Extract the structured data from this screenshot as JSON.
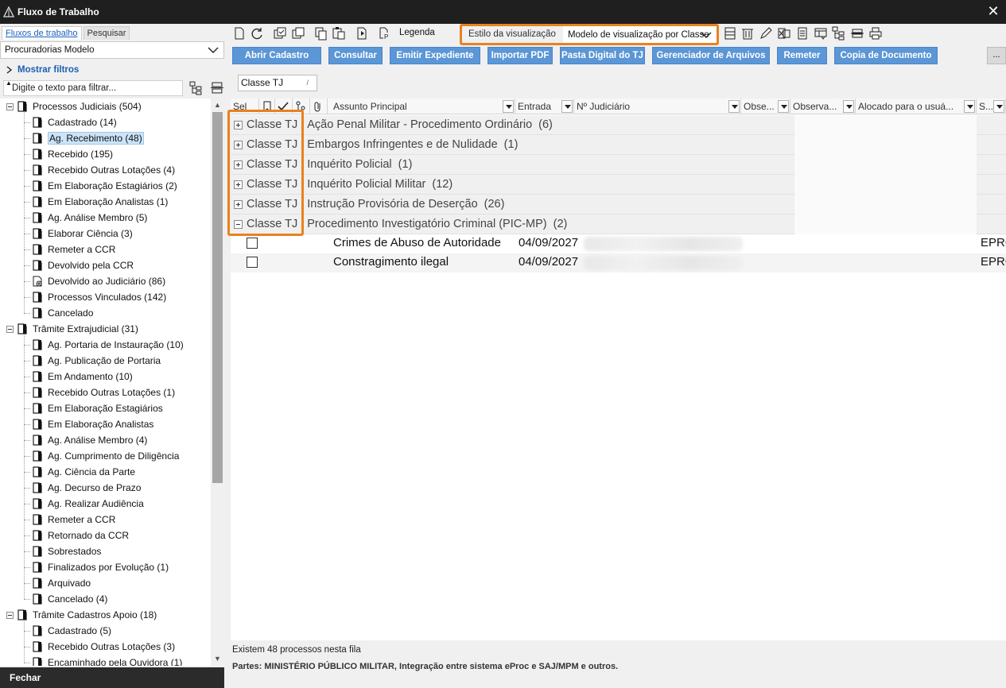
{
  "window": {
    "title": "Fluxo de Trabalho"
  },
  "left": {
    "tabs": [
      {
        "label": "Fluxos de trabalho"
      },
      {
        "label": "Pesquisar"
      }
    ],
    "model": "Procuradorias Modelo",
    "show_filters": "Mostrar filtros",
    "filter_placeholder": "Digite o texto para filtrar...",
    "tree": [
      {
        "label": "Processos Judiciais (504)",
        "level": 0
      },
      {
        "label": "Cadastrado (14)",
        "level": 1
      },
      {
        "label": "Ag. Recebimento (48)",
        "level": 1,
        "selected": true
      },
      {
        "label": "Recebido (195)",
        "level": 1
      },
      {
        "label": "Recebido Outras Lotações (4)",
        "level": 1
      },
      {
        "label": "Em Elaboração Estagiários (2)",
        "level": 1
      },
      {
        "label": "Em Elaboração Analistas (1)",
        "level": 1
      },
      {
        "label": "Ag. Análise Membro (5)",
        "level": 1
      },
      {
        "label": "Elaborar Ciência (3)",
        "level": 1
      },
      {
        "label": "Remeter a CCR",
        "level": 1
      },
      {
        "label": "Devolvido pela CCR",
        "level": 1
      },
      {
        "label": "Devolvido ao Judiciário (86)",
        "level": 1,
        "icon": "gear"
      },
      {
        "label": "Processos Vinculados (142)",
        "level": 1
      },
      {
        "label": "Cancelado",
        "level": 1
      },
      {
        "label": "Trâmite Extrajudicial (31)",
        "level": 0
      },
      {
        "label": "Ag. Portaria de Instauração (10)",
        "level": 1
      },
      {
        "label": "Ag. Publicação de Portaria",
        "level": 1
      },
      {
        "label": "Em Andamento (10)",
        "level": 1
      },
      {
        "label": "Recebido Outras Lotações (1)",
        "level": 1
      },
      {
        "label": "Em Elaboração Estagiários",
        "level": 1
      },
      {
        "label": "Em Elaboração Analistas",
        "level": 1
      },
      {
        "label": "Ag. Análise Membro (4)",
        "level": 1
      },
      {
        "label": "Ag. Cumprimento de Diligência",
        "level": 1
      },
      {
        "label": "Ag. Ciência da Parte",
        "level": 1
      },
      {
        "label": "Ag. Decurso de Prazo",
        "level": 1
      },
      {
        "label": "Ag. Realizar Audiência",
        "level": 1
      },
      {
        "label": "Remeter a CCR",
        "level": 1
      },
      {
        "label": "Retornado da CCR",
        "level": 1
      },
      {
        "label": "Sobrestados",
        "level": 1
      },
      {
        "label": "Finalizados por Evolução (1)",
        "level": 1
      },
      {
        "label": "Arquivado",
        "level": 1
      },
      {
        "label": "Cancelado (4)",
        "level": 1
      },
      {
        "label": "Trâmite Cadastros Apoio (18)",
        "level": 0
      },
      {
        "label": "Cadastrado (5)",
        "level": 1
      },
      {
        "label": "Recebido Outras Lotações (3)",
        "level": 1
      },
      {
        "label": "Encaminhado pela Ouvidora (1)",
        "level": 1
      }
    ],
    "close_label": "Fechar"
  },
  "toolbar": {
    "legend_label": "Legenda",
    "view_style_label": "Estilo da visualização",
    "view_style_value": "Modelo de visualização por Classe"
  },
  "actions": [
    {
      "label": "Abrir Cadastro"
    },
    {
      "label": "Consultar"
    },
    {
      "label": "Emitir Expediente"
    },
    {
      "label": "Importar PDF"
    },
    {
      "label": "Pasta Digital do TJ"
    },
    {
      "label": "Gerenciador de Arquivos"
    },
    {
      "label": "Remeter"
    },
    {
      "label": "Copia de Documento"
    }
  ],
  "more_label": "...",
  "grid": {
    "group_chip": "Classe TJ",
    "columns": [
      "Sel",
      "Assunto Principal",
      "Entrada",
      "Nº Judiciário",
      "Obse...",
      "Observa...",
      "Alocado para o usuá...",
      "S..."
    ],
    "groups": [
      {
        "prefix": "Classe TJ :",
        "name": "Ação Penal Militar - Procedimento Ordinário",
        "count": "(6)",
        "expanded": false
      },
      {
        "prefix": "Classe TJ :",
        "name": "Embargos Infringentes e de Nulidade",
        "count": "(1)",
        "expanded": false
      },
      {
        "prefix": "Classe TJ :",
        "name": "Inquérito Policial",
        "count": "(1)",
        "expanded": false
      },
      {
        "prefix": "Classe TJ :",
        "name": "Inquérito Policial Militar",
        "count": "(12)",
        "expanded": false
      },
      {
        "prefix": "Classe TJ :",
        "name": "Instrução Provisória de Deserção",
        "count": "(26)",
        "expanded": false
      },
      {
        "prefix": "Classe TJ :",
        "name": "Procedimento Investigatório Criminal (PIC-MP)",
        "count": "(2)",
        "expanded": true
      }
    ],
    "rows": [
      {
        "subject": "Crimes de Abuso de Autoridade",
        "date": "04/09/2027",
        "system": "EPROC"
      },
      {
        "subject": "Constragimento ilegal",
        "date": "04/09/2027",
        "system": "EPROC"
      }
    ]
  },
  "status": "Existem 48 processos nesta fila",
  "parts": "Partes: MINISTÉRIO PÚBLICO MILITAR, Integração entre sistema eProc e SAJ/MPM e outros.",
  "colors": {
    "accent": "#5b96d6",
    "highlight": "#e8821e",
    "titlebar": "#1f1f1f"
  }
}
